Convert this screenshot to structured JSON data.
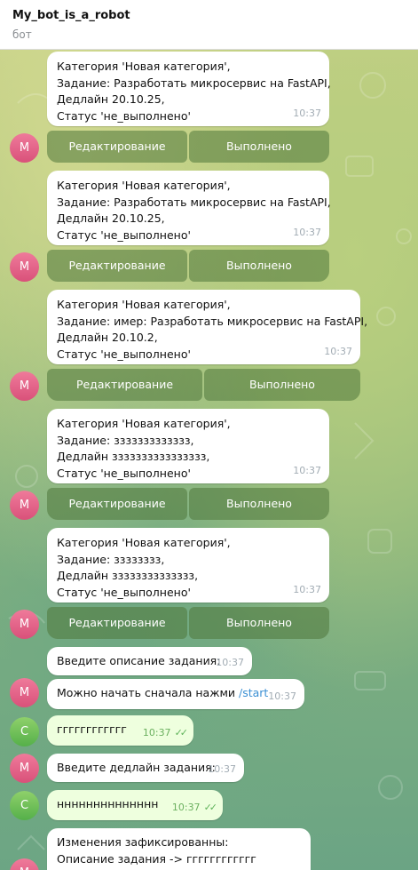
{
  "header": {
    "title": "My_bot_is_a_robot",
    "subtitle": "бот"
  },
  "avatars": {
    "bot": "M",
    "user": "C"
  },
  "messages": [
    {
      "lines": [
        "Категория 'Новая категория',",
        "Задание: Разработать микросервис на FastAPI,",
        "Дедлайн 20.10.25,",
        "Статус 'не_выполнено'"
      ],
      "time": "10:37",
      "buttons": [
        "Редактирование",
        "Выполнено"
      ]
    },
    {
      "lines": [
        "Категория 'Новая категория',",
        "Задание: Разработать микросервис на FastAPI,",
        "Дедлайн 20.10.25,",
        "Статус 'не_выполнено'"
      ],
      "time": "10:37",
      "buttons": [
        "Редактирование",
        "Выполнено"
      ]
    },
    {
      "lines": [
        "Категория 'Новая категория',",
        "Задание: имер: Разработать микросервис на FastAPI,",
        "Дедлайн 20.10.2,",
        "Статус 'не_выполнено'"
      ],
      "time": "10:37",
      "buttons": [
        "Редактирование",
        "Выполнено"
      ]
    },
    {
      "lines": [
        "Категория 'Новая категория',",
        "Задание: ззззззззззззз,",
        "Дедлайн зззззззззззззззз,",
        "Статус 'не_выполнено'"
      ],
      "time": "10:37",
      "buttons": [
        "Редактирование",
        "Выполнено"
      ]
    },
    {
      "lines": [
        "Категория 'Новая категория',",
        "Задание: зззззззз,",
        "Дедлайн зззззззззззззз,",
        "Статус 'не_выполнено'"
      ],
      "time": "10:37",
      "buttons": [
        "Редактирование",
        "Выполнено"
      ]
    },
    {
      "text": "Введите описание задания:",
      "time": "10:37"
    },
    {
      "text": "Можно начать сначала нажми",
      "link": "/start",
      "time": "10:37"
    },
    {
      "text": "гггггггггггг",
      "time": "10:37"
    },
    {
      "text": "Введите дедлайн задания:",
      "time": "10:37"
    },
    {
      "text": "нннннннннннннн",
      "time": "10:37"
    },
    {
      "lines": [
        "Изменения зафиксированны:",
        "Описание задания -> гггггггггггг"
      ]
    }
  ],
  "colors": {
    "bot_avatar": "#e0668a",
    "user_avatar": "#6cc04f",
    "link": "#3a8fd3",
    "check": "#5fb35a"
  },
  "icons": {
    "read_receipt": "double-check-icon"
  }
}
